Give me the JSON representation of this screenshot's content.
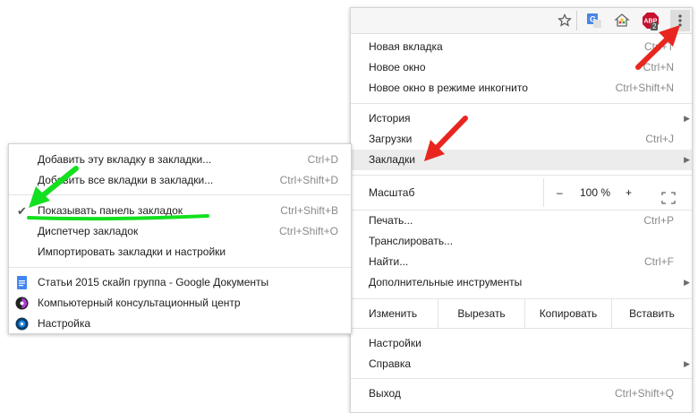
{
  "main_menu": {
    "items": [
      {
        "label": "Новая вкладка",
        "shortcut": "Ctrl+T"
      },
      {
        "label": "Новое окно",
        "shortcut": "Ctrl+N"
      },
      {
        "label": "Новое окно в режиме инкогнито",
        "shortcut": "Ctrl+Shift+N"
      },
      {
        "label": "История",
        "shortcut": ""
      },
      {
        "label": "Загрузки",
        "shortcut": "Ctrl+J"
      },
      {
        "label": "Закладки",
        "shortcut": ""
      },
      {
        "label": "Печать...",
        "shortcut": "Ctrl+P"
      },
      {
        "label": "Транслировать...",
        "shortcut": ""
      },
      {
        "label": "Найти...",
        "shortcut": "Ctrl+F"
      },
      {
        "label": "Дополнительные инструменты",
        "shortcut": ""
      },
      {
        "label": "Настройки",
        "shortcut": ""
      },
      {
        "label": "Справка",
        "shortcut": ""
      },
      {
        "label": "Выход",
        "shortcut": "Ctrl+Shift+Q"
      }
    ],
    "zoom": {
      "label": "Масштаб",
      "minus": "–",
      "value": "100 %",
      "plus": "+"
    },
    "edit": {
      "label": "Изменить",
      "cut": "Вырезать",
      "copy": "Копировать",
      "paste": "Вставить"
    },
    "toolbar": {
      "abp_badge": "2"
    }
  },
  "bookmarks_submenu": {
    "items": [
      {
        "label": "Добавить эту вкладку в закладки...",
        "shortcut": "Ctrl+D"
      },
      {
        "label": "Добавить все вкладки в закладки...",
        "shortcut": "Ctrl+Shift+D"
      },
      {
        "label": "Показывать панель закладок",
        "shortcut": "Ctrl+Shift+B"
      },
      {
        "label": "Диспетчер закладок",
        "shortcut": "Ctrl+Shift+O"
      },
      {
        "label": "Импортировать закладки и настройки",
        "shortcut": ""
      },
      {
        "label": "Статьи 2015 скайп группа - Google Документы",
        "shortcut": ""
      },
      {
        "label": "Компьютерный консультационный центр",
        "shortcut": ""
      },
      {
        "label": "Настройка",
        "shortcut": ""
      }
    ]
  },
  "colors": {
    "arrow_red": "#e8261f",
    "arrow_green": "#13e01f",
    "highlight": "#ececec"
  }
}
